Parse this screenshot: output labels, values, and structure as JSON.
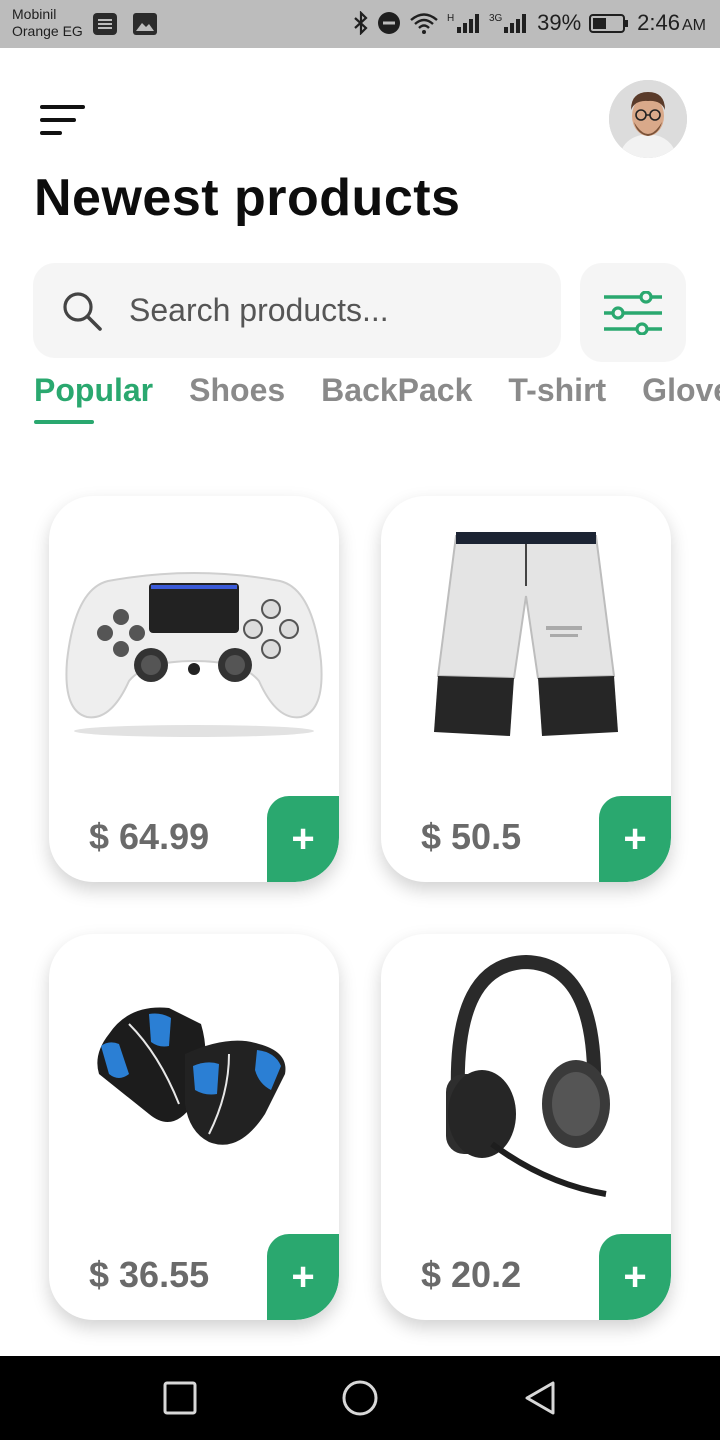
{
  "status_bar": {
    "carrier_line1": "Mobinil",
    "carrier_line2": "Orange EG",
    "battery": "39%",
    "time": "2:46",
    "ampm": "AM",
    "signal1_label": "H",
    "signal2_label": "3G"
  },
  "header": {
    "title": "Newest products"
  },
  "search": {
    "placeholder": "Search products..."
  },
  "tabs": [
    {
      "label": "Popular",
      "active": true
    },
    {
      "label": "Shoes",
      "active": false
    },
    {
      "label": "BackPack",
      "active": false
    },
    {
      "label": "T-shirt",
      "active": false
    },
    {
      "label": "Gloves",
      "active": false
    }
  ],
  "products": [
    {
      "name": "controller",
      "price": "$ 64.99",
      "add_label": "+"
    },
    {
      "name": "shorts",
      "price": "$ 50.5",
      "add_label": "+"
    },
    {
      "name": "gloves",
      "price": "$ 36.55",
      "add_label": "+"
    },
    {
      "name": "headphones",
      "price": "$ 20.2",
      "add_label": "+"
    }
  ],
  "colors": {
    "accent": "#2aa86f",
    "status_bar": "#bcbcbc",
    "nav_bar": "#000000"
  }
}
